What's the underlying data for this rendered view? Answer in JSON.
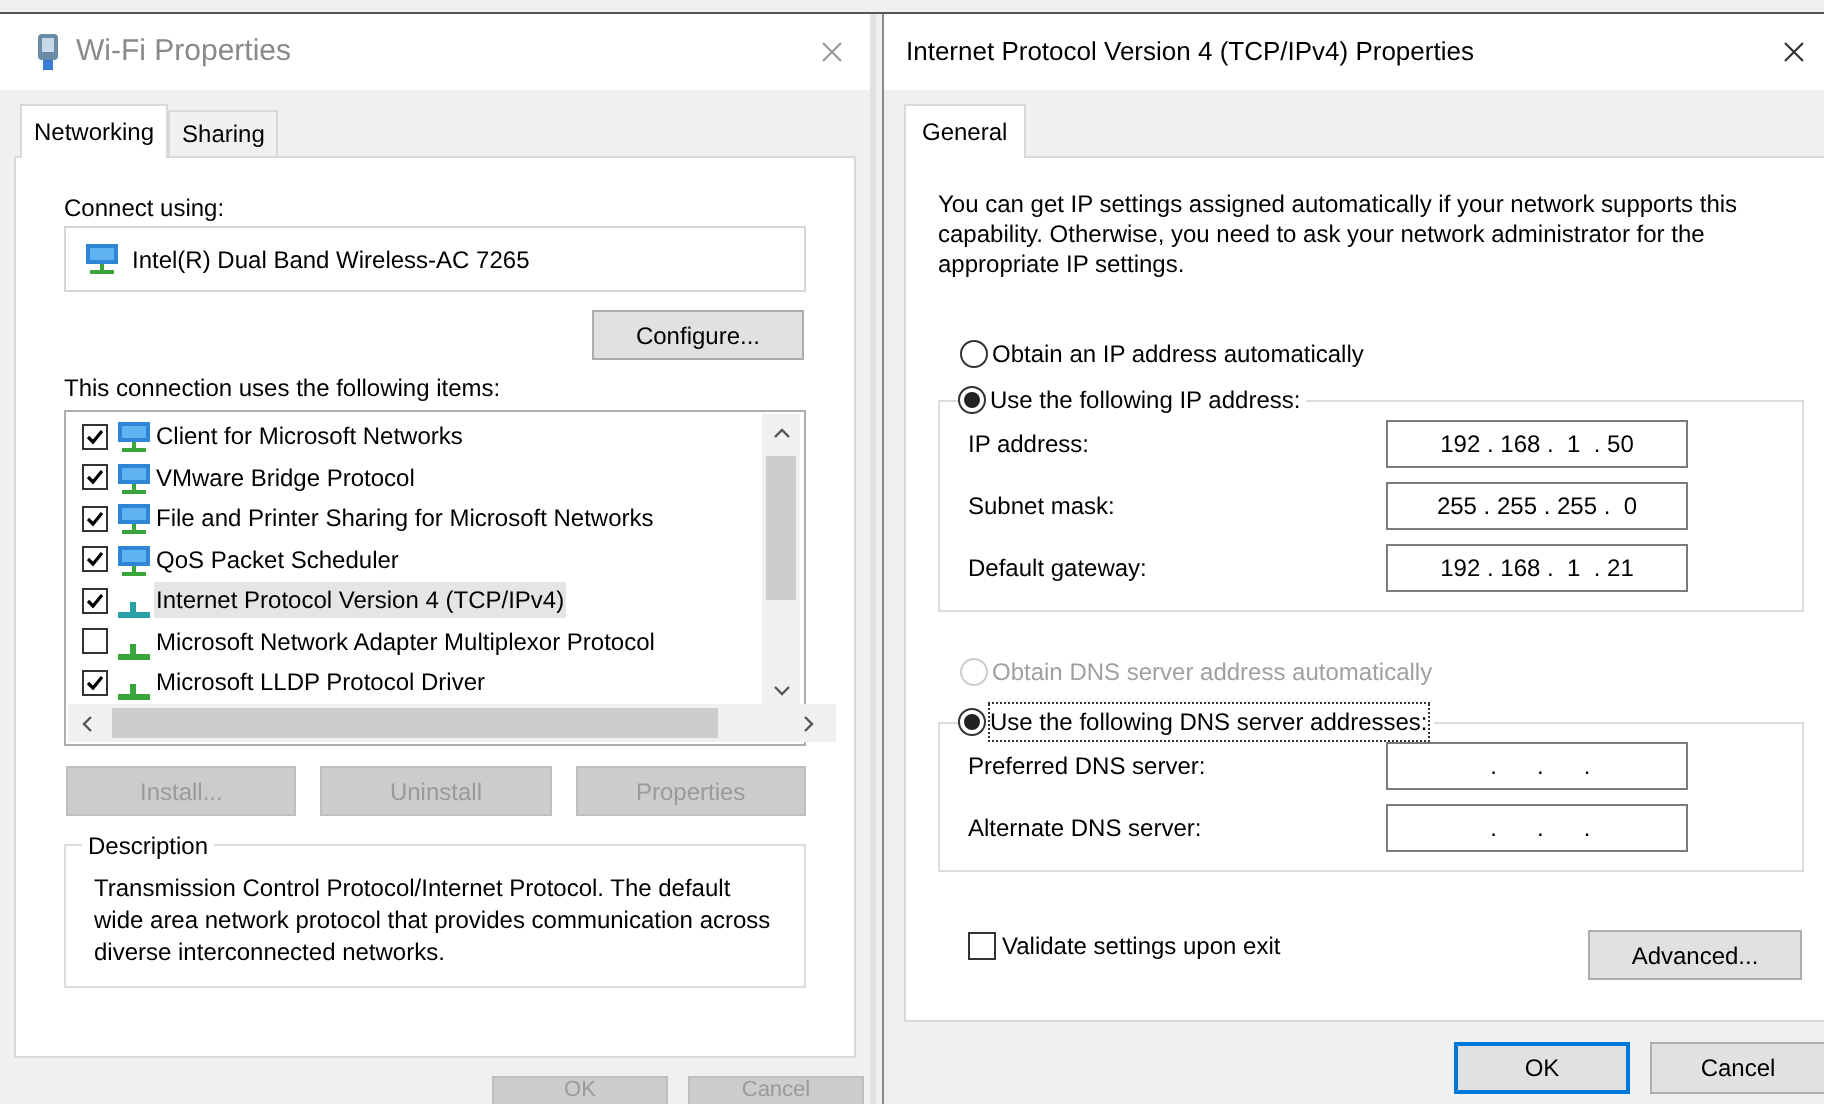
{
  "wifi_window": {
    "title": "Wi-Fi Properties",
    "tabs": [
      {
        "label": "Networking",
        "selected": true
      },
      {
        "label": "Sharing",
        "selected": false
      }
    ],
    "connect_using_label": "Connect using:",
    "adapter": "Intel(R) Dual Band Wireless-AC 7265",
    "configure_button": "Configure...",
    "items_label": "This connection uses the following items:",
    "items": [
      {
        "label": "Client for Microsoft Networks",
        "kind": "service",
        "checked": true,
        "selected": false
      },
      {
        "label": "VMware Bridge Protocol",
        "kind": "service",
        "checked": true,
        "selected": false
      },
      {
        "label": "File and Printer Sharing for Microsoft Networks",
        "kind": "service",
        "checked": true,
        "selected": false
      },
      {
        "label": "QoS Packet Scheduler",
        "kind": "service",
        "checked": true,
        "selected": false
      },
      {
        "label": "Internet Protocol Version 4 (TCP/IPv4)",
        "kind": "protocol",
        "checked": true,
        "selected": true
      },
      {
        "label": "Microsoft Network Adapter Multiplexor Protocol",
        "kind": "protocol",
        "checked": false,
        "selected": false
      },
      {
        "label": "Microsoft LLDP Protocol Driver",
        "kind": "protocol",
        "checked": true,
        "selected": false
      }
    ],
    "item_buttons": [
      {
        "label": "Install...",
        "disabled": true
      },
      {
        "label": "Uninstall",
        "disabled": true
      },
      {
        "label": "Properties",
        "disabled": true
      }
    ],
    "description": {
      "legend": "Description",
      "text": "Transmission Control Protocol/Internet Protocol. The default wide area network protocol that provides communication across diverse interconnected networks."
    },
    "dialog_buttons": [
      {
        "label": "OK",
        "disabled": true
      },
      {
        "label": "Cancel",
        "disabled": true
      }
    ]
  },
  "ipv4_window": {
    "title": "Internet Protocol Version 4 (TCP/IPv4) Properties",
    "tabs": [
      {
        "label": "General",
        "selected": true
      }
    ],
    "intro": "You can get IP settings assigned automatically if your network supports this capability. Otherwise, you need to ask your network administrator for the appropriate IP settings.",
    "ip_options": [
      {
        "label": "Obtain an IP address automatically",
        "selected": false,
        "disabled": false,
        "focused": false
      },
      {
        "label": "Use the following IP address:",
        "selected": true,
        "disabled": false,
        "focused": false
      }
    ],
    "ip_fields": [
      {
        "label": "IP address:",
        "value": "192 . 168 .  1  . 50"
      },
      {
        "label": "Subnet mask:",
        "value": "255 . 255 . 255 .  0"
      },
      {
        "label": "Default gateway:",
        "value": "192 . 168 .  1  . 21"
      }
    ],
    "dns_options": [
      {
        "label": "Obtain DNS server address automatically",
        "selected": false,
        "disabled": true,
        "focused": false
      },
      {
        "label": "Use the following DNS server addresses:",
        "selected": true,
        "disabled": false,
        "focused": true
      }
    ],
    "dns_fields": [
      {
        "label": "Preferred DNS server:",
        "value": "      .      .      .     "
      },
      {
        "label": "Alternate DNS server:",
        "value": "      .      .      .     "
      }
    ],
    "validate": {
      "label": "Validate settings upon exit",
      "checked": false
    },
    "advanced_button": "Advanced...",
    "dialog_buttons": [
      {
        "label": "OK",
        "default": true
      },
      {
        "label": "Cancel",
        "default": false
      }
    ]
  }
}
